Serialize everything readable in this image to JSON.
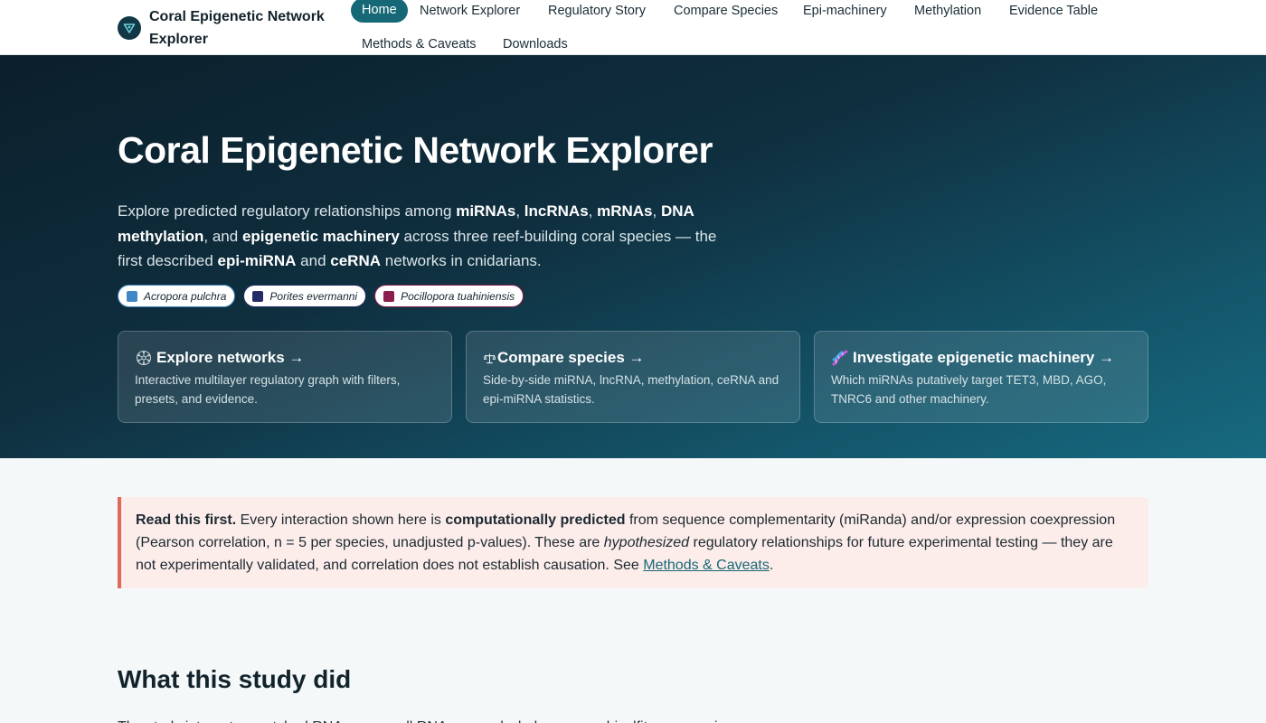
{
  "header": {
    "brand_title": "Coral Epigenetic Network Explorer",
    "nav": [
      {
        "label": "Home",
        "active": true
      },
      {
        "label": "Network Explorer"
      },
      {
        "label": "Regulatory Story"
      },
      {
        "label": "Compare Species"
      },
      {
        "label": "Epi-machinery"
      },
      {
        "label": "Methylation"
      },
      {
        "label": "Evidence Table"
      },
      {
        "label": "Methods & Caveats"
      },
      {
        "label": "Downloads"
      }
    ]
  },
  "hero": {
    "title": "Coral Epigenetic Network Explorer",
    "intro": {
      "p1": "Explore predicted regulatory relationships among ",
      "b1": "miRNAs",
      "p2": ", ",
      "b2": "lncRNAs",
      "p3": ", ",
      "b3": "mRNAs",
      "p4": ", ",
      "b4": "DNA methylation",
      "p5": ", and ",
      "b5": "epigenetic machinery",
      "p6": " across three reef-building coral species — the first described ",
      "b6": "epi-miRNA",
      "p7": " and ",
      "b7": "ceRNA",
      "p8": " networks in cnidarians."
    },
    "species": [
      {
        "name": "Acropora pulchra",
        "color": "#3f88c5"
      },
      {
        "name": "Porites evermanni",
        "color": "#252b66"
      },
      {
        "name": "Pocillopora tuahiniensis",
        "color": "#8a1e4e"
      }
    ],
    "cards": [
      {
        "icon": "network-icon",
        "title": "Explore networks →",
        "desc": "Interactive multilayer regulatory graph with filters, presets, and evidence."
      },
      {
        "icon": "balance-scale-icon",
        "title": "Compare species →",
        "desc": "Side-by-side miRNA, lncRNA, methylation, ceRNA and epi-miRNA statistics."
      },
      {
        "icon": "dna-icon",
        "title": "Investigate epigenetic machinery →",
        "desc": "Which miRNAs putatively target TET3, MBD, AGO, TNRC6 and other machinery."
      }
    ]
  },
  "notice": {
    "lead": "Read this first.",
    "t1": " Every interaction shown here is ",
    "b1": "computationally predicted",
    "t2": " from sequence complementarity (miRanda) and/or expression coexpression (Pearson correlation, n = 5 per species, unadjusted p-values). These are ",
    "i1": "hypothesized",
    "t3": " regulatory relationships for future experimental testing — they are not experimentally validated, and correlation does not establish causation. See ",
    "link": "Methods & Caveats",
    "t4": "."
  },
  "section": {
    "title": "What this study did",
    "body": "The study integrates matched RNA-seq, small RNA-seq and whole-genome bisulfite sequencing..."
  }
}
